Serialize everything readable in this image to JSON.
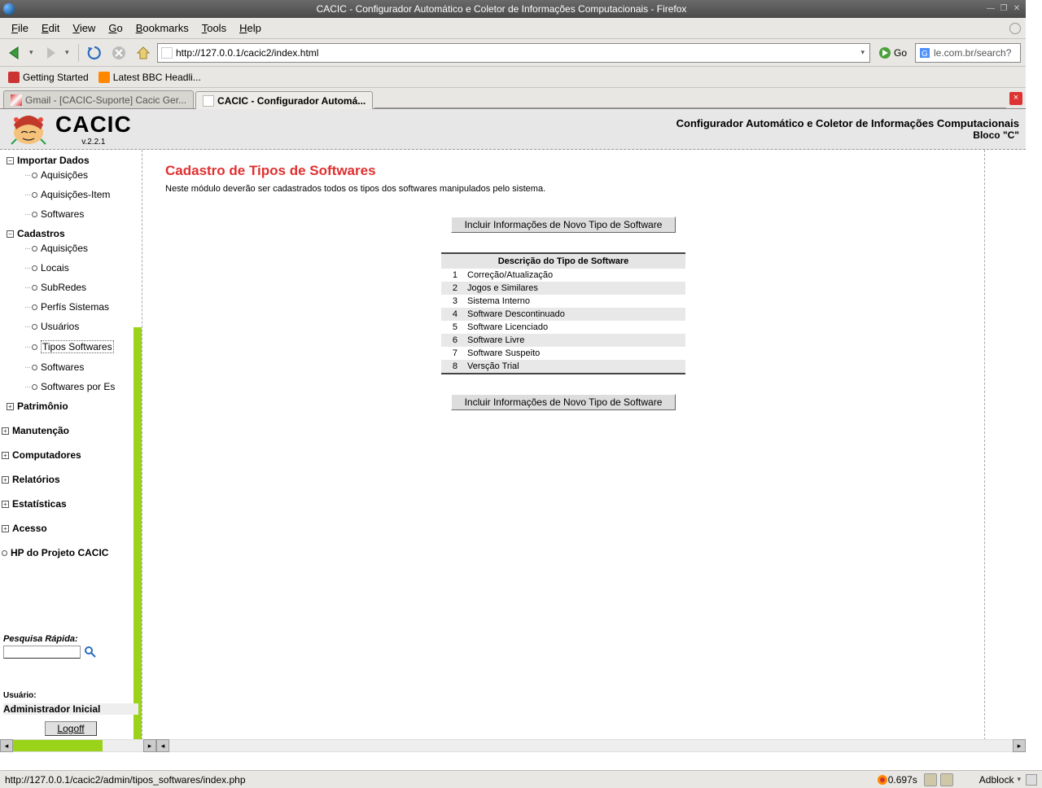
{
  "window": {
    "title": "CACIC - Configurador Automático e Coletor de Informações Computacionais - Firefox"
  },
  "menubar": [
    "File",
    "Edit",
    "View",
    "Go",
    "Bookmarks",
    "Tools",
    "Help"
  ],
  "nav": {
    "url": "http://127.0.0.1/cacic2/index.html",
    "go": "Go",
    "search_placeholder": "le.com.br/search?"
  },
  "bookmarks": [
    {
      "label": "Getting Started"
    },
    {
      "label": "Latest BBC Headli..."
    }
  ],
  "tabs": [
    {
      "label": "Gmail - [CACIC-Suporte] Cacic Ger...",
      "active": false
    },
    {
      "label": "CACIC - Configurador Automá...",
      "active": true
    }
  ],
  "app": {
    "brand": "CACIC",
    "version": "v.2.2.1",
    "subtitle1": "Configurador Automático e Coletor de Informações Computacionais",
    "subtitle2": "Bloco \"C\""
  },
  "tree": {
    "importar": {
      "label": "Importar Dados",
      "items": [
        "Aquisições",
        "Aquisições-Item",
        "Softwares"
      ]
    },
    "cadastros": {
      "label": "Cadastros",
      "items": [
        "Aquisições",
        "Locais",
        "SubRedes",
        "Perfís Sistemas",
        "Usuários",
        "Tipos Softwares",
        "Softwares",
        "Softwares por Es"
      ],
      "selected": "Tipos Softwares"
    },
    "patrimonio": "Patrimônio",
    "manutencao": "Manutenção",
    "computadores": "Computadores",
    "relatorios": "Relatórios",
    "estatisticas": "Estatísticas",
    "acesso": "Acesso",
    "hp": "HP do Projeto CACIC"
  },
  "sidebar": {
    "pesquisa_label": "Pesquisa Rápida:",
    "usuario_label": "Usuário:",
    "usuario_value": "Administrador Inicial",
    "logoff": "Logoff"
  },
  "content": {
    "heading": "Cadastro de Tipos de Softwares",
    "desc": "Neste módulo deverão ser cadastrados todos os tipos dos softwares manipulados pelo sistema.",
    "button": "Incluir Informações de Novo Tipo de Software",
    "table_header": "Descrição do Tipo de Software",
    "rows": [
      "Correção/Atualização",
      "Jogos e Similares",
      "Sistema Interno",
      "Software Descontinuado",
      "Software Licenciado",
      "Software Livre",
      "Software Suspeito",
      "Versção Trial"
    ]
  },
  "status": {
    "text": "http://127.0.0.1/cacic2/admin/tipos_softwares/index.php",
    "timing": "0.697s",
    "adblock": "Adblock"
  }
}
